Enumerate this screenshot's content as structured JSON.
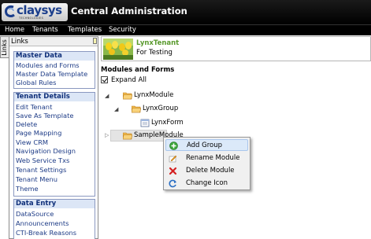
{
  "header": {
    "logo_text": "claysys",
    "logo_sub": "TECHNOLOGIES",
    "app_title": "Central Administration"
  },
  "menu": {
    "items": [
      "Home",
      "Tenants",
      "Templates",
      "Security"
    ]
  },
  "sidebar": {
    "tab_label": "Links",
    "panel_title": "Links",
    "groups": [
      {
        "title": "Master Data",
        "links": [
          "Modules and Forms",
          "Master Data Template",
          "Global Rules"
        ]
      },
      {
        "title": "Tenant Details",
        "links": [
          "Edit Tenant",
          "Save As Template",
          "Delete",
          "Page Mapping",
          "View CRM",
          "Navigation Design",
          "Web Service Txs",
          "Tenant Settings",
          "Tenant Menu",
          "Theme"
        ]
      },
      {
        "title": "Data Entry",
        "links": [
          "DataSource",
          "Announcements",
          "CTI-Break Reasons"
        ]
      }
    ]
  },
  "tenant": {
    "name": "LynxTenant",
    "description": "For Testing"
  },
  "modules": {
    "title": "Modules and Forms",
    "expand_all_label": "Expand All",
    "expand_all_checked": true,
    "tree": [
      "LynxModule",
      "LynxGroup",
      "LynxForm",
      "SampleModule"
    ]
  },
  "context_menu": {
    "items": [
      {
        "label": "Add Group",
        "icon": "add-icon"
      },
      {
        "label": "Rename Module",
        "icon": "pencil-icon"
      },
      {
        "label": "Delete Module",
        "icon": "delete-x-icon"
      },
      {
        "label": "Change Icon",
        "icon": "refresh-icon"
      }
    ],
    "highlighted": "Add Group"
  },
  "colors": {
    "header_bg": "#000000",
    "link": "#1d3b86",
    "group_title_bg": "#dce6f6",
    "tenant_name": "#5a9a2e",
    "menu_hover": "#dbe9f9"
  }
}
